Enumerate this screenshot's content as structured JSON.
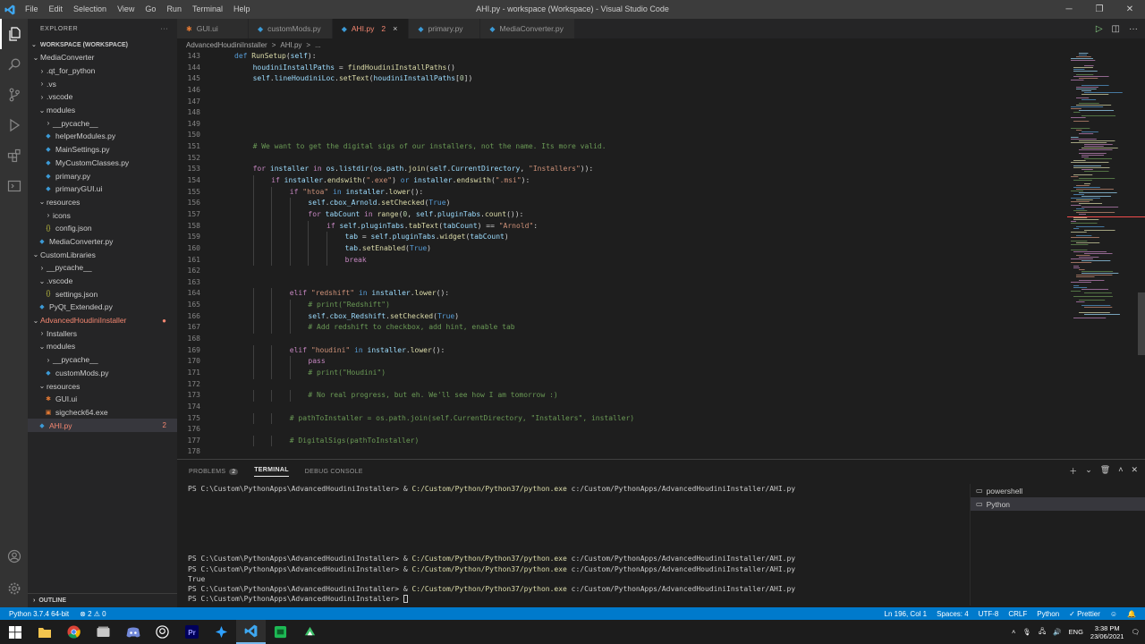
{
  "window": {
    "title": "AHI.py - workspace (Workspace) - Visual Studio Code",
    "menu": [
      "File",
      "Edit",
      "Selection",
      "View",
      "Go",
      "Run",
      "Terminal",
      "Help"
    ]
  },
  "explorer": {
    "header": "EXPLORER",
    "workspace": "WORKSPACE (WORKSPACE)",
    "tree": [
      {
        "label": "MediaConverter",
        "depth": 1,
        "kind": "folder-open"
      },
      {
        "label": ".qt_for_python",
        "depth": 2,
        "kind": "folder"
      },
      {
        "label": ".vs",
        "depth": 2,
        "kind": "folder"
      },
      {
        "label": ".vscode",
        "depth": 2,
        "kind": "folder"
      },
      {
        "label": "modules",
        "depth": 2,
        "kind": "folder-open"
      },
      {
        "label": "__pycache__",
        "depth": 3,
        "kind": "folder"
      },
      {
        "label": "helperModules.py",
        "depth": 3,
        "kind": "py"
      },
      {
        "label": "MainSettings.py",
        "depth": 3,
        "kind": "py"
      },
      {
        "label": "MyCustomClasses.py",
        "depth": 3,
        "kind": "py"
      },
      {
        "label": "primary.py",
        "depth": 3,
        "kind": "py"
      },
      {
        "label": "primaryGUI.ui",
        "depth": 3,
        "kind": "py"
      },
      {
        "label": "resources",
        "depth": 2,
        "kind": "folder-open"
      },
      {
        "label": "icons",
        "depth": 3,
        "kind": "folder"
      },
      {
        "label": "config.json",
        "depth": 3,
        "kind": "json"
      },
      {
        "label": "MediaConverter.py",
        "depth": 2,
        "kind": "py"
      },
      {
        "label": "CustomLibraries",
        "depth": 1,
        "kind": "folder-open"
      },
      {
        "label": "__pycache__",
        "depth": 2,
        "kind": "folder"
      },
      {
        "label": ".vscode",
        "depth": 2,
        "kind": "folder-open"
      },
      {
        "label": "settings.json",
        "depth": 3,
        "kind": "json"
      },
      {
        "label": "PyQt_Extended.py",
        "depth": 2,
        "kind": "py"
      },
      {
        "label": "AdvancedHoudiniInstaller",
        "depth": 1,
        "kind": "folder-open",
        "red": true,
        "dot": "●"
      },
      {
        "label": "Installers",
        "depth": 2,
        "kind": "folder"
      },
      {
        "label": "modules",
        "depth": 2,
        "kind": "folder-open"
      },
      {
        "label": "__pycache__",
        "depth": 3,
        "kind": "folder"
      },
      {
        "label": "customMods.py",
        "depth": 3,
        "kind": "py"
      },
      {
        "label": "resources",
        "depth": 2,
        "kind": "folder-open"
      },
      {
        "label": "GUI.ui",
        "depth": 3,
        "kind": "ui"
      },
      {
        "label": "sigcheck64.exe",
        "depth": 3,
        "kind": "exe"
      },
      {
        "label": "AHI.py",
        "depth": 2,
        "kind": "py",
        "red": true,
        "selected": true,
        "count": "2"
      }
    ],
    "outline": "OUTLINE"
  },
  "tabs": [
    {
      "label": "GUI.ui",
      "icon": "ui"
    },
    {
      "label": "customMods.py",
      "icon": "py"
    },
    {
      "label": "AHI.py",
      "icon": "py",
      "active": true,
      "problems": "2",
      "close": "×"
    },
    {
      "label": "primary.py",
      "icon": "py"
    },
    {
      "label": "MediaConverter.py",
      "icon": "py"
    }
  ],
  "breadcrumb": [
    "AdvancedHoudiniInstaller",
    ">",
    "AHI.py",
    ">",
    "..."
  ],
  "code_lines": [
    {
      "n": "143",
      "indent": 0,
      "html": "<span class='df'>def</span> <span class='fn'>RunSetup</span>(<span class='vb'>self</span>):"
    },
    {
      "n": "144",
      "indent": 1,
      "html": "<span class='vb'>houdiniInstallPaths</span> = <span class='fn'>findHoudiniInstallPaths</span>()"
    },
    {
      "n": "145",
      "indent": 1,
      "html": "<span class='vb'>self</span>.<span class='vb'>lineHoudiniLoc</span>.<span class='fn'>setText</span>(<span class='vb'>houdiniInstallPaths</span>[<span class='nm'>0</span>])"
    },
    {
      "n": "146",
      "indent": 0,
      "html": ""
    },
    {
      "n": "147",
      "indent": 0,
      "html": ""
    },
    {
      "n": "148",
      "indent": 0,
      "html": ""
    },
    {
      "n": "149",
      "indent": 0,
      "html": ""
    },
    {
      "n": "150",
      "indent": 0,
      "html": ""
    },
    {
      "n": "151",
      "indent": 1,
      "html": "<span class='cm'># We want to get the digital sigs of our installers, not the name. Its more valid.</span>"
    },
    {
      "n": "152",
      "indent": 0,
      "html": ""
    },
    {
      "n": "153",
      "indent": 1,
      "html": "<span class='kw'>for</span> <span class='vb'>installer</span> <span class='kw'>in</span> <span class='vb'>os</span>.<span class='vb'>listdir</span>(<span class='vb'>os</span>.<span class='vb'>path</span>.<span class='fn'>join</span>(<span class='vb'>self</span>.<span class='vb'>CurrentDirectory</span>, <span class='st'>\"Installers\"</span>)):"
    },
    {
      "n": "154",
      "indent": 2,
      "html": "<span class='kw'>if</span> <span class='vb'>installer</span>.<span class='fn'>endswith</span>(<span class='st'>\".exe\"</span>) <span class='bl'>or</span> <span class='vb'>installer</span>.<span class='fn'>endswith</span>(<span class='st'>\".msi\"</span>):"
    },
    {
      "n": "155",
      "indent": 3,
      "html": "<span class='kw'>if</span> <span class='st'>\"htoa\"</span> <span class='bl'>in</span> <span class='vb'>installer</span>.<span class='fn'>lower</span>():"
    },
    {
      "n": "156",
      "indent": 4,
      "html": "<span class='vb'>self</span>.<span class='vb'>cbox_Arnold</span>.<span class='fn'>setChecked</span>(<span class='bl'>True</span>)"
    },
    {
      "n": "157",
      "indent": 4,
      "html": "<span class='kw'>for</span> <span class='vb'>tabCount</span> <span class='kw'>in</span> <span class='fn'>range</span>(<span class='nm'>0</span>, <span class='vb'>self</span>.<span class='vb'>pluginTabs</span>.<span class='fn'>count</span>()):"
    },
    {
      "n": "158",
      "indent": 5,
      "html": "<span class='kw'>if</span> <span class='vb'>self</span>.<span class='vb'>pluginTabs</span>.<span class='fn'>tabText</span>(<span class='vb'>tabCount</span>) == <span class='st'>\"Arnold\"</span>:"
    },
    {
      "n": "159",
      "indent": 6,
      "html": "<span class='vb'>tab</span> = <span class='vb'>self</span>.<span class='vb'>pluginTabs</span>.<span class='fn'>widget</span>(<span class='vb'>tabCount</span>)"
    },
    {
      "n": "160",
      "indent": 6,
      "html": "<span class='vb'>tab</span>.<span class='fn'>setEnabled</span>(<span class='bl'>True</span>)"
    },
    {
      "n": "161",
      "indent": 6,
      "html": "<span class='kw'>break</span>"
    },
    {
      "n": "162",
      "indent": 0,
      "html": ""
    },
    {
      "n": "163",
      "indent": 0,
      "html": ""
    },
    {
      "n": "164",
      "indent": 3,
      "html": "<span class='kw'>elif</span> <span class='st'>\"redshift\"</span> <span class='bl'>in</span> <span class='vb'>installer</span>.<span class='fn'>lower</span>():"
    },
    {
      "n": "165",
      "indent": 4,
      "html": "<span class='cm'># print(\"Redshift\")</span>"
    },
    {
      "n": "166",
      "indent": 4,
      "html": "<span class='vb'>self</span>.<span class='vb'>cbox_Redshift</span>.<span class='fn'>setChecked</span>(<span class='bl'>True</span>)"
    },
    {
      "n": "167",
      "indent": 4,
      "html": "<span class='cm'># Add redshift to checkbox, add hint, enable tab</span>"
    },
    {
      "n": "168",
      "indent": 0,
      "html": ""
    },
    {
      "n": "169",
      "indent": 3,
      "html": "<span class='kw'>elif</span> <span class='st'>\"houdini\"</span> <span class='bl'>in</span> <span class='vb'>installer</span>.<span class='fn'>lower</span>():"
    },
    {
      "n": "170",
      "indent": 4,
      "html": "<span class='kw'>pass</span>"
    },
    {
      "n": "171",
      "indent": 4,
      "html": "<span class='cm'># print(\"Houdini\")</span>"
    },
    {
      "n": "172",
      "indent": 0,
      "html": ""
    },
    {
      "n": "173",
      "indent": 4,
      "html": "<span class='cm'># No real progress, but eh. We'll see how I am tomorrow :)</span>"
    },
    {
      "n": "174",
      "indent": 0,
      "html": ""
    },
    {
      "n": "175",
      "indent": 3,
      "html": "<span class='cm'># pathToInstaller = os.path.join(self.CurrentDirectory, \"Installers\", installer)</span>"
    },
    {
      "n": "176",
      "indent": 0,
      "html": ""
    },
    {
      "n": "177",
      "indent": 3,
      "html": "<span class='cm'># DigitalSigs(pathToInstaller)</span>"
    },
    {
      "n": "178",
      "indent": 0,
      "html": ""
    }
  ],
  "panel": {
    "tabs": [
      {
        "label": "PROBLEMS",
        "badge": "2"
      },
      {
        "label": "TERMINAL",
        "active": true
      },
      {
        "label": "DEBUG CONSOLE"
      }
    ],
    "terminal_lines": [
      {
        "prompt": "PS C:\\Custom\\PythonApps\\AdvancedHoudiniInstaller> & ",
        "cmd": "C:/Custom/Python/Python37/python.exe",
        "arg": " c:/Custom/PythonApps/AdvancedHoudiniInstaller/AHI.py"
      },
      {
        "prompt": "",
        "cmd": "",
        "arg": ""
      },
      {
        "prompt": "",
        "cmd": "",
        "arg": ""
      },
      {
        "prompt": "",
        "cmd": "",
        "arg": ""
      },
      {
        "prompt": "",
        "cmd": "",
        "arg": ""
      },
      {
        "prompt": "",
        "cmd": "",
        "arg": ""
      },
      {
        "prompt": "",
        "cmd": "",
        "arg": ""
      },
      {
        "prompt": "PS C:\\Custom\\PythonApps\\AdvancedHoudiniInstaller> & ",
        "cmd": "C:/Custom/Python/Python37/python.exe",
        "arg": " c:/Custom/PythonApps/AdvancedHoudiniInstaller/AHI.py"
      },
      {
        "prompt": "PS C:\\Custom\\PythonApps\\AdvancedHoudiniInstaller> & ",
        "cmd": "C:/Custom/Python/Python37/python.exe",
        "arg": " c:/Custom/PythonApps/AdvancedHoudiniInstaller/AHI.py"
      },
      {
        "prompt": "True",
        "cmd": "",
        "arg": ""
      },
      {
        "prompt": "PS C:\\Custom\\PythonApps\\AdvancedHoudiniInstaller> & ",
        "cmd": "C:/Custom/Python/Python37/python.exe",
        "arg": " c:/Custom/PythonApps/AdvancedHoudiniInstaller/AHI.py"
      },
      {
        "prompt": "PS C:\\Custom\\PythonApps\\AdvancedHoudiniInstaller> ",
        "cmd": "",
        "arg": "",
        "cursor": true
      }
    ],
    "terminals": [
      {
        "label": "powershell"
      },
      {
        "label": "Python",
        "selected": true
      }
    ]
  },
  "status": {
    "python": "Python 3.7.4 64-bit",
    "problems": "⊗ 2 ⚠ 0",
    "position": "Ln 196, Col 1",
    "spaces": "Spaces: 4",
    "encoding": "UTF-8",
    "eol": "CRLF",
    "language": "Python",
    "prettier": "✓ Prettier"
  },
  "taskbar": {
    "lang": "ENG",
    "time": "3:38 PM",
    "date": "23/06/2021"
  },
  "colors": {
    "accent": "#007acc",
    "error": "#f48771",
    "editor_bg": "#1e1e1e"
  }
}
